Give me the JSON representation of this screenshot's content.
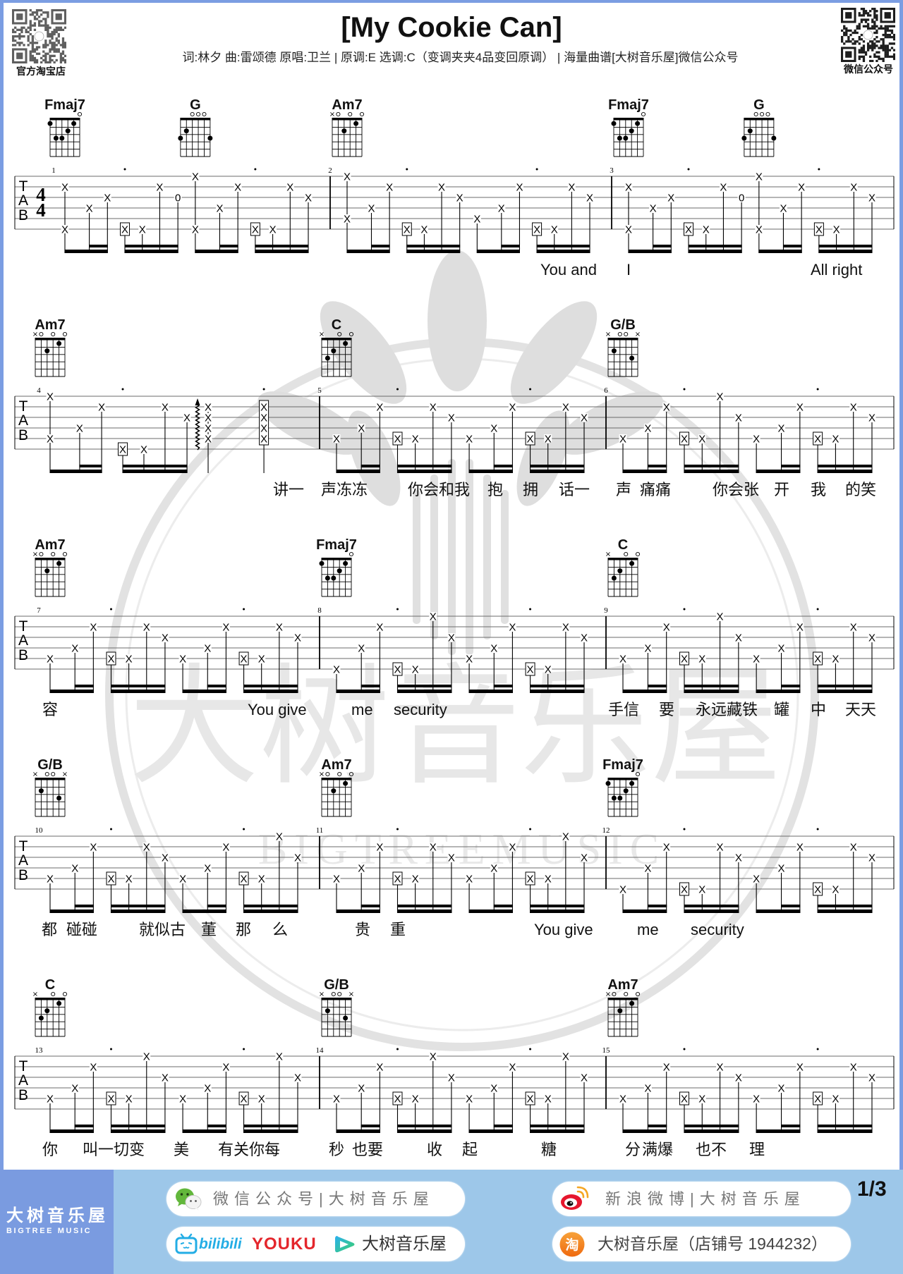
{
  "header": {
    "title": "[My Cookie Can]",
    "subtitle": "词:林夕 曲:雷颂德 原唱:卫兰 | 原调:E  选调:C（变调夹夹4品变回原调） | 海量曲谱[大树音乐屋]微信公众号",
    "qr_left_label": "官方淘宝店",
    "qr_right_label": "微信公众号"
  },
  "tab": {
    "clef": [
      "T",
      "A",
      "B"
    ],
    "time_signature": {
      "top": "4",
      "bottom": "4"
    },
    "default_mark": "X"
  },
  "chord_shapes": {
    "Fmaj7": [
      1,
      3,
      3,
      2,
      1,
      0
    ],
    "G": [
      3,
      2,
      0,
      0,
      0,
      3
    ],
    "Am7": [
      "x",
      0,
      2,
      0,
      1,
      0
    ],
    "C": [
      "x",
      3,
      2,
      0,
      1,
      0
    ],
    "G/B": [
      "x",
      2,
      0,
      0,
      3,
      "x"
    ]
  },
  "systems": [
    {
      "measures": [
        {
          "number": 1,
          "chords": [
            {
              "name": "Fmaj7",
              "beat": 1
            },
            {
              "name": "G",
              "beat": 3
            }
          ],
          "beats": [
            [
              "2+6",
              "4",
              "3"
            ],
            [
              "[6]",
              "6",
              "2",
              "3=0"
            ],
            [
              "1+6",
              "4",
              "2"
            ],
            [
              "[6]",
              "6",
              "2",
              "3"
            ]
          ]
        },
        {
          "number": 2,
          "chords": [
            {
              "name": "Am7",
              "beat": 1
            }
          ],
          "beats": [
            [
              "1+5",
              "4",
              "2"
            ],
            [
              "[6]",
              "6",
              "2",
              "3"
            ],
            [
              "5",
              "4",
              "2"
            ],
            [
              "[6]",
              "6",
              "2",
              "3"
            ]
          ]
        },
        {
          "number": 3,
          "chords": [
            {
              "name": "Fmaj7",
              "beat": 1
            },
            {
              "name": "G",
              "beat": 3
            }
          ],
          "beats": [
            [
              "2+6",
              "4",
              "3"
            ],
            [
              "[6]",
              "6",
              "2",
              "3=0"
            ],
            [
              "1+6",
              "4",
              "2"
            ],
            [
              "[6]",
              "6",
              "2",
              "3"
            ]
          ]
        }
      ],
      "lyrics": [
        "You and",
        "I",
        "All right"
      ]
    },
    {
      "measures": [
        {
          "number": 4,
          "chords": [
            {
              "name": "Am7",
              "beat": 1
            }
          ],
          "beats": [
            [
              "1+5",
              "4",
              "2"
            ],
            [
              "[6]",
              "6",
              "2",
              "3"
            ],
            [
              "~2+3+4+5"
            ],
            [
              "[2+3+4+5]"
            ]
          ]
        },
        {
          "number": 5,
          "chords": [
            {
              "name": "C",
              "beat": 1
            }
          ],
          "beats": [
            [
              "5",
              "4",
              "2"
            ],
            [
              "[5]",
              "5",
              "2",
              "3"
            ],
            [
              "5",
              "4",
              "2"
            ],
            [
              "[5]",
              "5",
              "2",
              "3"
            ]
          ]
        },
        {
          "number": 6,
          "chords": [
            {
              "name": "G/B",
              "beat": 1
            }
          ],
          "beats": [
            [
              "5",
              "4",
              "2"
            ],
            [
              "[5]",
              "5",
              "1",
              "3"
            ],
            [
              "5",
              "4",
              "2"
            ],
            [
              "[5]",
              "5",
              "2",
              "3"
            ]
          ]
        }
      ],
      "lyrics": [
        "讲一",
        "声冻冻",
        "你会和我",
        "抱",
        "拥",
        "话一",
        "声",
        "痛痛",
        "你会张",
        "开",
        "我",
        "的笑"
      ]
    },
    {
      "measures": [
        {
          "number": 7,
          "chords": [
            {
              "name": "Am7",
              "beat": 1
            }
          ],
          "beats": [
            [
              "5",
              "4",
              "2"
            ],
            [
              "[5]",
              "5",
              "2",
              "3"
            ],
            [
              "5",
              "4",
              "2"
            ],
            [
              "[5]",
              "5",
              "2",
              "3"
            ]
          ]
        },
        {
          "number": 8,
          "chords": [
            {
              "name": "Fmaj7",
              "beat": 1
            }
          ],
          "beats": [
            [
              "6",
              "4",
              "2"
            ],
            [
              "[6]",
              "6",
              "1",
              "3"
            ],
            [
              "5",
              "4",
              "2"
            ],
            [
              "[6]",
              "6",
              "2",
              "3"
            ]
          ]
        },
        {
          "number": 9,
          "chords": [
            {
              "name": "C",
              "beat": 1
            }
          ],
          "beats": [
            [
              "5",
              "4",
              "2"
            ],
            [
              "[5]",
              "5",
              "1",
              "3"
            ],
            [
              "5",
              "4",
              "2"
            ],
            [
              "[5]",
              "5",
              "2",
              "3"
            ]
          ]
        }
      ],
      "lyrics": [
        "容",
        "You give",
        "me",
        "security",
        "手信",
        "要",
        "永远藏铁",
        "罐",
        "中",
        "天天"
      ]
    },
    {
      "measures": [
        {
          "number": 10,
          "chords": [
            {
              "name": "G/B",
              "beat": 1
            }
          ],
          "beats": [
            [
              "5",
              "4",
              "2"
            ],
            [
              "[5]",
              "5",
              "2",
              "3"
            ],
            [
              "5",
              "4",
              "2"
            ],
            [
              "[5]",
              "5",
              "1",
              "3"
            ]
          ]
        },
        {
          "number": 11,
          "chords": [
            {
              "name": "Am7",
              "beat": 1
            }
          ],
          "beats": [
            [
              "5",
              "4",
              "2"
            ],
            [
              "[5]",
              "5",
              "2",
              "3"
            ],
            [
              "5",
              "4",
              "2"
            ],
            [
              "[5]",
              "5",
              "1",
              "3"
            ]
          ]
        },
        {
          "number": 12,
          "chords": [
            {
              "name": "Fmaj7",
              "beat": 1
            }
          ],
          "beats": [
            [
              "6",
              "4",
              "2"
            ],
            [
              "[6]",
              "6",
              "2",
              "3"
            ],
            [
              "5",
              "4",
              "2"
            ],
            [
              "[6]",
              "6",
              "2",
              "3"
            ]
          ]
        }
      ],
      "lyrics": [
        "都",
        "碰碰",
        "就似古",
        "董",
        "那",
        "么",
        "贵",
        "重",
        "You give",
        "me",
        "security"
      ]
    },
    {
      "measures": [
        {
          "number": 13,
          "chords": [
            {
              "name": "C",
              "beat": 1
            }
          ],
          "beats": [
            [
              "5",
              "4",
              "2"
            ],
            [
              "[5]",
              "5",
              "1",
              "3"
            ],
            [
              "5",
              "4",
              "2"
            ],
            [
              "[5]",
              "5",
              "1",
              "3"
            ]
          ]
        },
        {
          "number": 14,
          "chords": [
            {
              "name": "G/B",
              "beat": 1
            }
          ],
          "beats": [
            [
              "5",
              "4",
              "2"
            ],
            [
              "[5]",
              "5",
              "1",
              "3"
            ],
            [
              "5",
              "4",
              "2"
            ],
            [
              "[5]",
              "5",
              "1",
              "3"
            ]
          ]
        },
        {
          "number": 15,
          "chords": [
            {
              "name": "Am7",
              "beat": 1
            }
          ],
          "beats": [
            [
              "5",
              "4",
              "2"
            ],
            [
              "[5]",
              "5",
              "2",
              "3"
            ],
            [
              "5",
              "4",
              "2"
            ],
            [
              "[5]",
              "5",
              "2",
              "3"
            ]
          ]
        }
      ],
      "lyrics": [
        "你",
        "叫一切变",
        "美",
        "有关你每",
        "秒",
        "也要",
        "收",
        "起",
        "糖",
        "分",
        "满爆",
        "也不",
        "理"
      ]
    }
  ],
  "watermark": {
    "text_cn": "大树音乐屋",
    "text_en": "BIGTREEMUSIC"
  },
  "footer": {
    "brand_cn": "大树音乐屋",
    "brand_en": "BIGTREE MUSIC",
    "wechat_text": "微信公众号|大树音乐屋",
    "bilibili_word": "bilibili",
    "youku_word": "YOUKU",
    "video_text": "大树音乐屋",
    "weibo_text": "新浪微博|大树音乐屋",
    "taobao_icon_glyph": "淘",
    "taobao_text": "大树音乐屋（店铺号 1944232）",
    "page_indicator": "1/3"
  },
  "colors": {
    "border": "#7b9de2",
    "footer_left": "#7a9be0",
    "footer_right": "#9dc7e9",
    "bili": "#23ade5",
    "youku": "#e4262c",
    "wechat": "#62b73b",
    "weibo": "#e6162d",
    "taobao": "#f27b13"
  }
}
